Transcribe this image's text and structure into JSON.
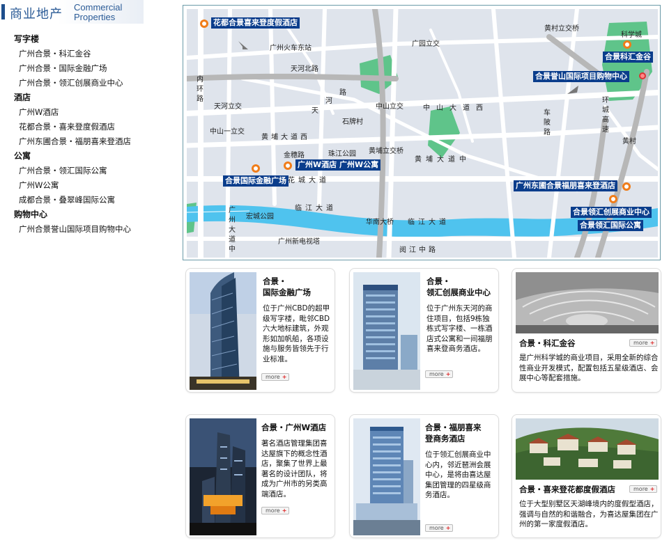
{
  "header": {
    "title_cn": "商业地产",
    "title_en_1": "Commercial",
    "title_en_2": "Properties"
  },
  "sidebar": {
    "sections": [
      {
        "title": "写字楼",
        "items": [
          "广州合景・科汇金谷",
          "广州合景・国际金融广场",
          "广州合景・领汇创展商业中心"
        ]
      },
      {
        "title": "酒店",
        "items": [
          "广州W酒店",
          "花都合景・喜来登度假酒店",
          "广州东圃合景・福朋喜来登酒店"
        ]
      },
      {
        "title": "公寓",
        "items": [
          "广州合景・领汇国际公寓",
          "广州W公寓",
          "成都合景・叠翠峰国际公寓"
        ]
      },
      {
        "title": "购物中心",
        "items": [
          "广州合景誉山国际项目购物中心"
        ]
      }
    ]
  },
  "map": {
    "tags": {
      "huadu": "花都合景喜来登度假酒店",
      "kehui": "合景科汇金谷",
      "yushan": "合景誉山国际项目购物中心",
      "w_hotel": "广州W酒店",
      "w_apt": "广州W公寓",
      "ifc": "合景国际金融广场",
      "fourpoints": "广州东圃合景福朋喜来登酒店",
      "linghui_center": "合景领汇创展商业中心",
      "linghui_apt": "合景领汇国际公寓"
    },
    "labels": {
      "huangcun": "黄村立交桥",
      "kexuecheng": "科学城",
      "guangyuan": "广园立交",
      "huochedong": "广州火车东站",
      "tianhebei": "天河北路",
      "neihuan": "内环路",
      "tianhe_li": "天河立交",
      "tianhe_road_1": "天",
      "tianhe_road_2": "河",
      "tianhe_road_3": "路",
      "zhongshan_li": "中山立交",
      "zhongshan1": "中山一立交",
      "shipaicun": "石牌村",
      "zhongshan_dadao": "中山大道西",
      "chepo": "车陂路",
      "huancheng": "环城高速",
      "huangcun2": "黄村",
      "huangpu": "黄埔大道西",
      "jinsui": "金穗路",
      "zhujiang": "珠江公园",
      "huangpu_li": "黄埔立交桥",
      "huangpu_dadao": "黄埔大道中",
      "huacheng": "花城大道",
      "linjiang": "临江大道",
      "linjiang2": "临江大道",
      "hongcheng": "宏城公园",
      "huanan": "华南大桥",
      "guangzhou_dadao": "广州大道中",
      "tower": "广州新电视塔",
      "yuejiang": "阅江中路"
    }
  },
  "cards": [
    {
      "title_1": "合景・",
      "title_2": "国际金融广场",
      "desc": "位于广州CBD的超甲级写字楼，毗邻CBD六大地标建筑，外观形如加帆船，各项设施与服务皆领先于行业标准。",
      "more": "more"
    },
    {
      "title_1": "合景・",
      "title_2": "领汇创展商业中心",
      "desc": "位于广州东天河的商住项目，包括9栋独栋式写字楼、一栋酒店式公寓和一间福朋喜来登商务酒店。",
      "more": "more"
    },
    {
      "title_1": "合景・科汇金谷",
      "title_2": "",
      "desc": "是广州科学城的商业项目，采用全新的综合性商业开发模式，配置包括五星级酒店、会展中心等配套措施。",
      "more": "more"
    },
    {
      "title_1": "合景・广州W酒店",
      "title_2": "",
      "desc": "著名酒店管理集团喜达屋旗下的概念性酒店，聚集了世界上最著名的设计团队，将成为广州市的另类高端酒店。",
      "more": "more"
    },
    {
      "title_1": "合景・福朋喜来",
      "title_2": "登商务酒店",
      "desc": "位于领汇创展商业中心内，邻近琶洲会展中心，是将由喜达屋集团管理的四星级商务酒店。",
      "more": "more"
    },
    {
      "title_1": "合景・喜来登花都度假酒店",
      "title_2": "",
      "desc": "位于大型别墅区天湖峰境内的度假型酒店，强调与自然的和谐融合，为喜达屋集团在广州的第一家度假酒店。",
      "more": "more"
    }
  ],
  "colors": {
    "accent": "#1e4e8c",
    "map_green": "#5fc48a",
    "map_water": "#4fc3ee",
    "map_tag": "#0a3d8c",
    "marker": "#f07d1a"
  }
}
